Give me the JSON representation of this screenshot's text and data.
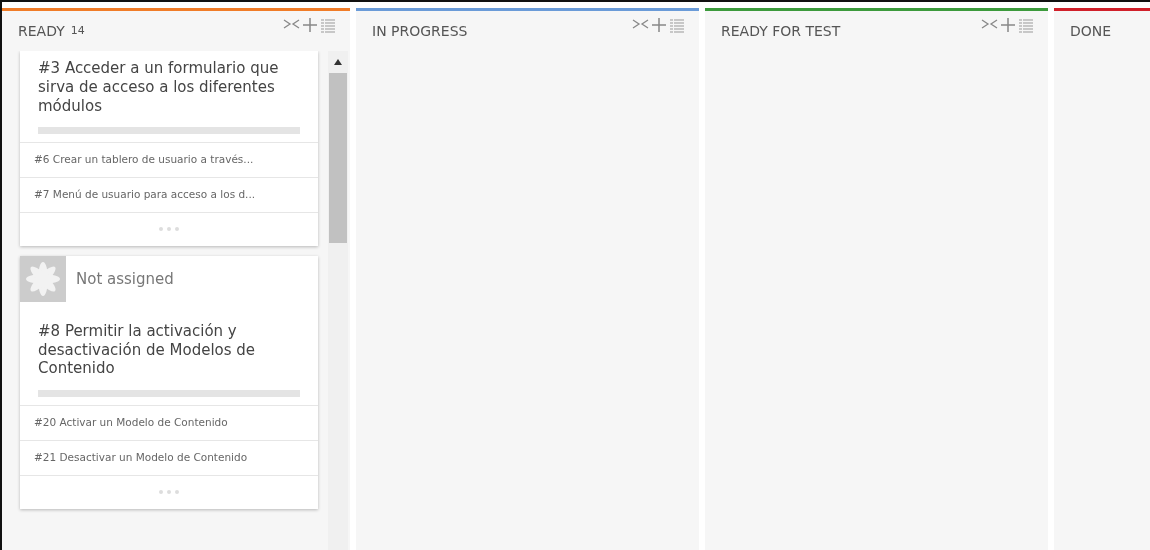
{
  "columns": [
    {
      "title": "READY",
      "count": "14",
      "color": "#f07c28",
      "tools": true,
      "cards": [
        {
          "title": "#3 Acceder a un formulario que sirva de acceso a los diferentes módulos",
          "tasks": [
            "#6 Crear un tablero de usuario a través...",
            "#7 Menú de usuario para acceso a los d..."
          ]
        },
        {
          "assignee": "Not assigned",
          "title": "#8 Permitir la activación y desactivación de Modelos de Contenido",
          "tasks": [
            "#20 Activar un Modelo de Contenido",
            "#21 Desactivar un Modelo de Contenido"
          ]
        }
      ]
    },
    {
      "title": "IN PROGRESS",
      "color": "#6a9bd8",
      "tools": true
    },
    {
      "title": "READY FOR TEST",
      "color": "#3c9a3c",
      "tools": true
    },
    {
      "title": "DONE",
      "color": "#d0202a",
      "tools": false
    }
  ]
}
